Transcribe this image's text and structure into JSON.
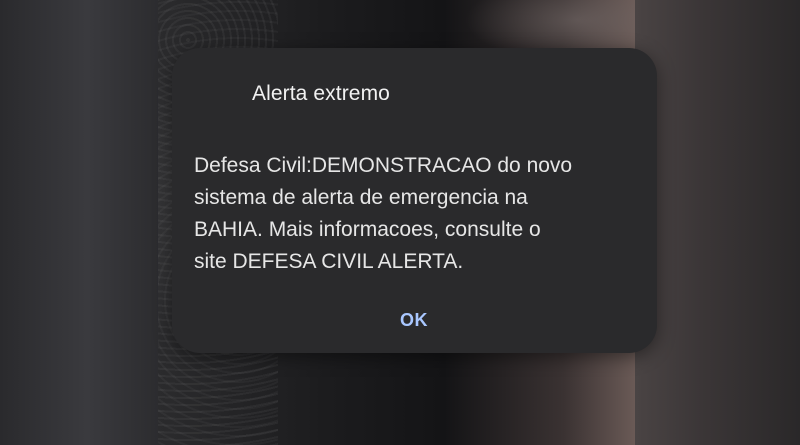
{
  "alert": {
    "title": "Alerta extremo",
    "body_lines": [
      "Defesa Civil:DEMONSTRACAO do novo",
      "sistema de alerta de emergencia na",
      "BAHIA. Mais informacoes, consulte o",
      "site DEFESA CIVIL ALERTA."
    ],
    "ok_label": "OK"
  },
  "colors": {
    "dialog_background": "#2a2a2c",
    "title_text": "#f2f2f2",
    "body_text": "#e6e6e6",
    "accent": "#a9c7ff"
  }
}
